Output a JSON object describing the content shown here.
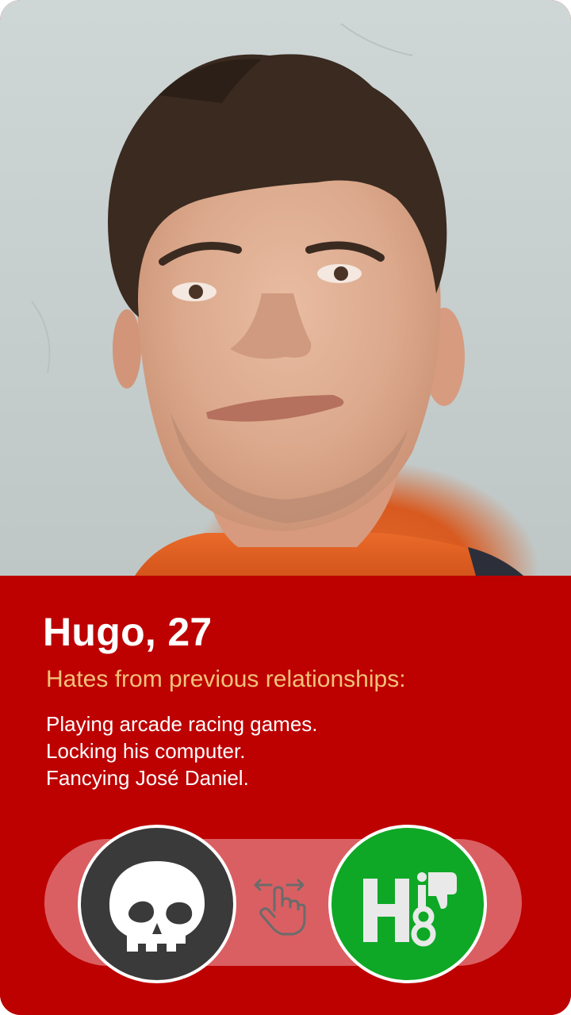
{
  "profile": {
    "name_age": "Hugo, 27",
    "photo_subject": "profile-photo"
  },
  "hates": {
    "heading": "Hates from previous relationships:",
    "items": [
      "Playing arcade racing games.",
      "Locking his computer.",
      "Fancying José Daniel."
    ]
  },
  "actions": {
    "pass_icon": "skull-icon",
    "hate_icon": "h8-thumbs-down-logo",
    "hint_icon": "swipe-hand-icon"
  },
  "colors": {
    "panel": "#bd0000",
    "heading": "#f3c27a",
    "track": "#da5f62",
    "pass_button": "#3a3a3a",
    "hate_button": "#0ea826"
  }
}
